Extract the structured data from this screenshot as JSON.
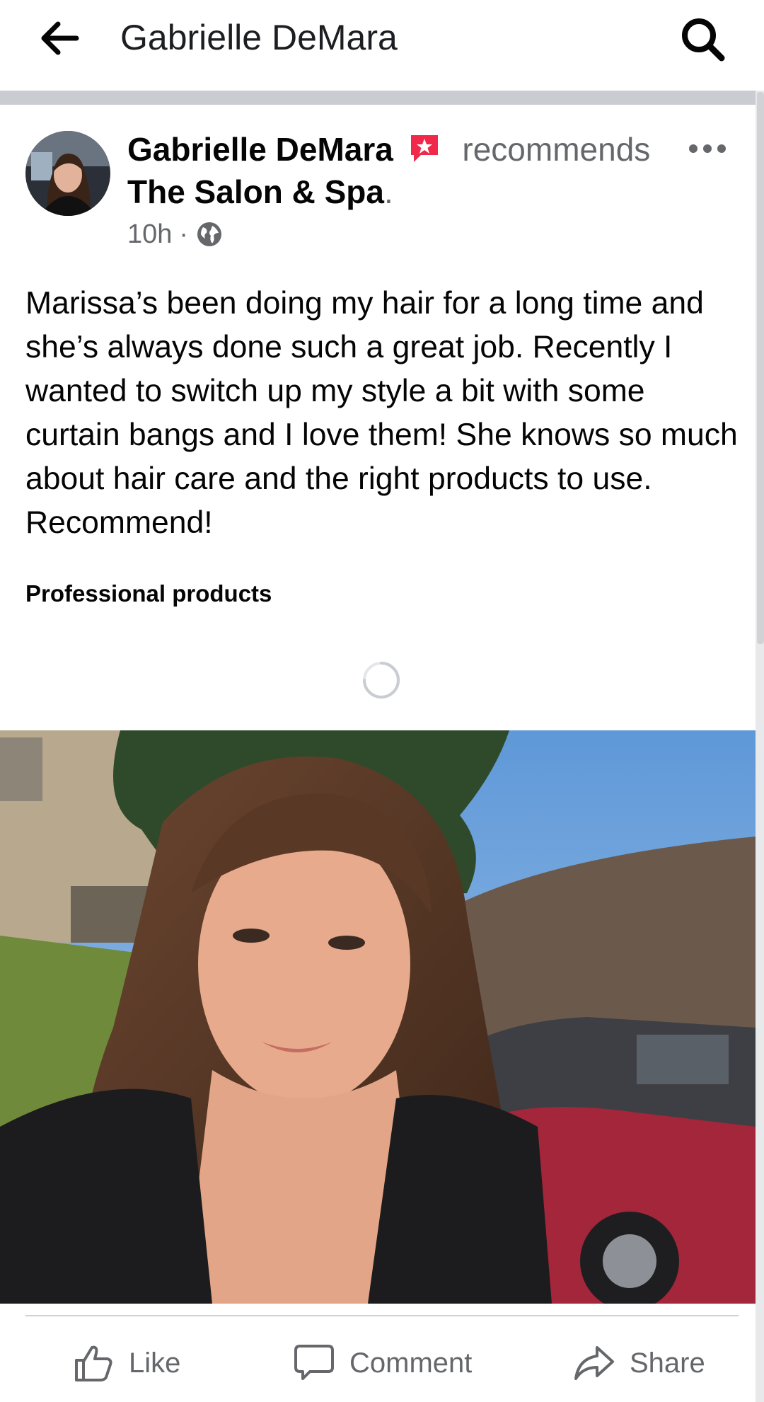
{
  "header": {
    "title": "Gabrielle DeMara",
    "back_icon": "arrow-left-icon",
    "search_icon": "search-icon"
  },
  "post": {
    "author": "Gabrielle DeMara",
    "action": "recommends",
    "page": "The Salon & Spa",
    "page_suffix": ".",
    "time": "10h",
    "separator": "·",
    "privacy_icon": "globe-icon",
    "recommend_icon": "recommend-star-icon",
    "more_icon": "more-horizontal-icon",
    "text": "Marissa’s been doing my hair for a long time and she’s always done such a great job. Recently I wanted to switch up my style a bit with some curtain bangs and I love them! She knows so much about hair care and the right products to use. Recommend!",
    "tag": "Professional products",
    "loading_icon": "loading-spinner-icon"
  },
  "actions": {
    "like": "Like",
    "comment": "Comment",
    "share": "Share"
  },
  "colors": {
    "recommend_badge": "#f02849",
    "secondary_text": "#65676b",
    "divider": "#c9ccd1"
  }
}
